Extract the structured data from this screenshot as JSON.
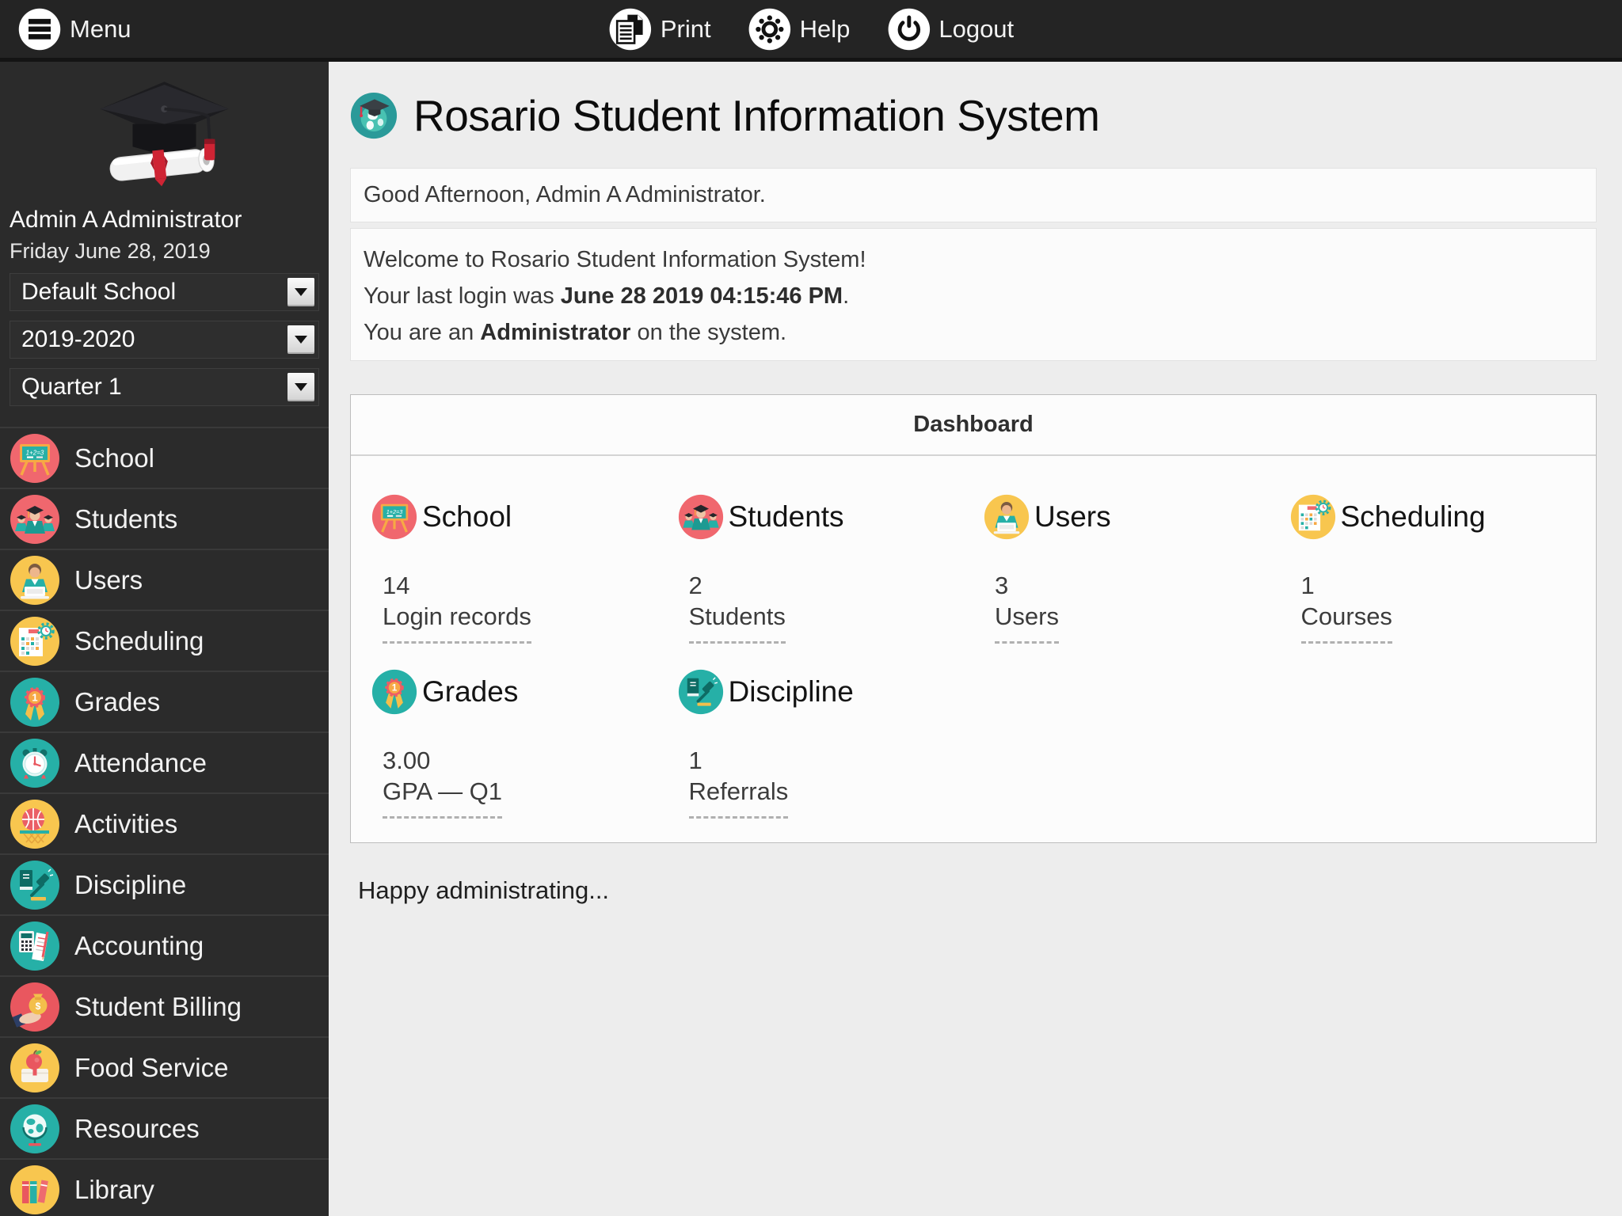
{
  "topbar": {
    "menu": "Menu",
    "print": "Print",
    "help": "Help",
    "logout": "Logout"
  },
  "sidebar": {
    "user_name": "Admin A Administrator",
    "date": "Friday June 28, 2019",
    "school_select": {
      "value": "Default School"
    },
    "year_select": {
      "value": "2019-2020"
    },
    "term_select": {
      "value": "Quarter 1"
    },
    "items": [
      {
        "icon": "school-icon",
        "label": "School"
      },
      {
        "icon": "students-icon",
        "label": "Students"
      },
      {
        "icon": "users-icon",
        "label": "Users"
      },
      {
        "icon": "scheduling-icon",
        "label": "Scheduling"
      },
      {
        "icon": "grades-icon",
        "label": "Grades"
      },
      {
        "icon": "attendance-icon",
        "label": "Attendance"
      },
      {
        "icon": "activities-icon",
        "label": "Activities"
      },
      {
        "icon": "discipline-icon",
        "label": "Discipline"
      },
      {
        "icon": "accounting-icon",
        "label": "Accounting"
      },
      {
        "icon": "student-billing-icon",
        "label": "Student Billing"
      },
      {
        "icon": "food-service-icon",
        "label": "Food Service"
      },
      {
        "icon": "resources-icon",
        "label": "Resources"
      },
      {
        "icon": "library-icon",
        "label": "Library"
      }
    ]
  },
  "main": {
    "title": "Rosario Student Information System",
    "greeting": "Good Afternoon, Admin A Administrator.",
    "welcome_line1": "Welcome to Rosario Student Information System!",
    "welcome_line2_prefix": "Your last login was ",
    "welcome_line2_bold": "June 28 2019 04:15:46 PM",
    "welcome_line2_suffix": ".",
    "welcome_line3_prefix": "You are an ",
    "welcome_line3_bold": "Administrator",
    "welcome_line3_suffix": " on the system.",
    "dashboard": {
      "title": "Dashboard",
      "tiles": [
        {
          "icon": "school-icon",
          "label": "School",
          "value": "14",
          "metric": "Login records"
        },
        {
          "icon": "students-icon",
          "label": "Students",
          "value": "2",
          "metric": "Students"
        },
        {
          "icon": "users-icon",
          "label": "Users",
          "value": "3",
          "metric": "Users"
        },
        {
          "icon": "scheduling-icon",
          "label": "Scheduling",
          "value": "1",
          "metric": "Courses"
        },
        {
          "icon": "grades-icon",
          "label": "Grades",
          "value": "3.00",
          "metric": "GPA — Q1"
        },
        {
          "icon": "discipline-icon",
          "label": "Discipline",
          "value": "1",
          "metric": "Referrals"
        }
      ]
    },
    "footer_note": "Happy administrating..."
  },
  "colors": {
    "teal": "#26b0a7",
    "pink": "#f0676e",
    "yellow": "#f8c64f",
    "red": "#e9575f",
    "topbar_bg": "#242424",
    "sidebar_bg": "#2b2b2b",
    "content_bg": "#ededed",
    "panel_bg": "#fcfcfc"
  }
}
